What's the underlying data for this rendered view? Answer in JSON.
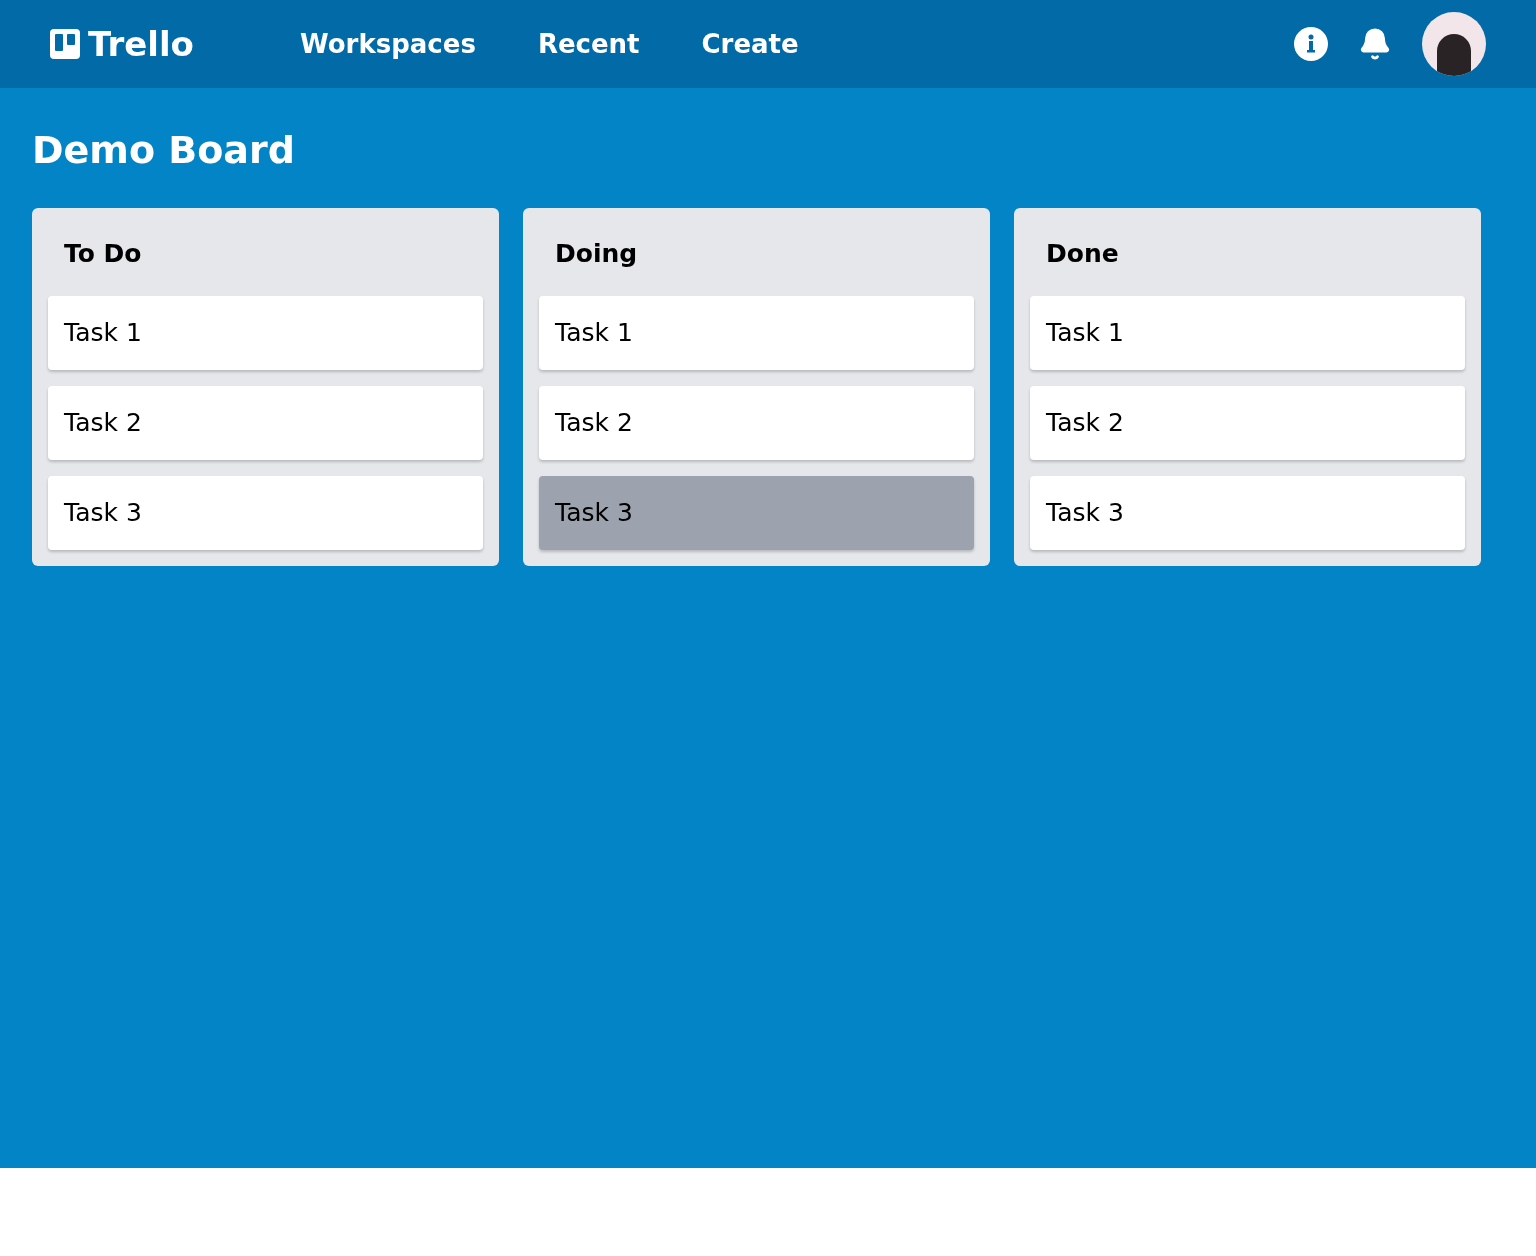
{
  "header": {
    "logo": "Trello",
    "nav": [
      "Workspaces",
      "Recent",
      "Create"
    ]
  },
  "board": {
    "title": "Demo Board",
    "lists": [
      {
        "title": "To Do",
        "cards": [
          {
            "label": "Task 1",
            "selected": false
          },
          {
            "label": "Task 2",
            "selected": false
          },
          {
            "label": "Task 3",
            "selected": false
          }
        ]
      },
      {
        "title": "Doing",
        "cards": [
          {
            "label": "Task 1",
            "selected": false
          },
          {
            "label": "Task 2",
            "selected": false
          },
          {
            "label": "Task 3",
            "selected": true
          }
        ]
      },
      {
        "title": "Done",
        "cards": [
          {
            "label": "Task 1",
            "selected": false
          },
          {
            "label": "Task 2",
            "selected": false
          },
          {
            "label": "Task 3",
            "selected": false
          }
        ]
      }
    ]
  }
}
